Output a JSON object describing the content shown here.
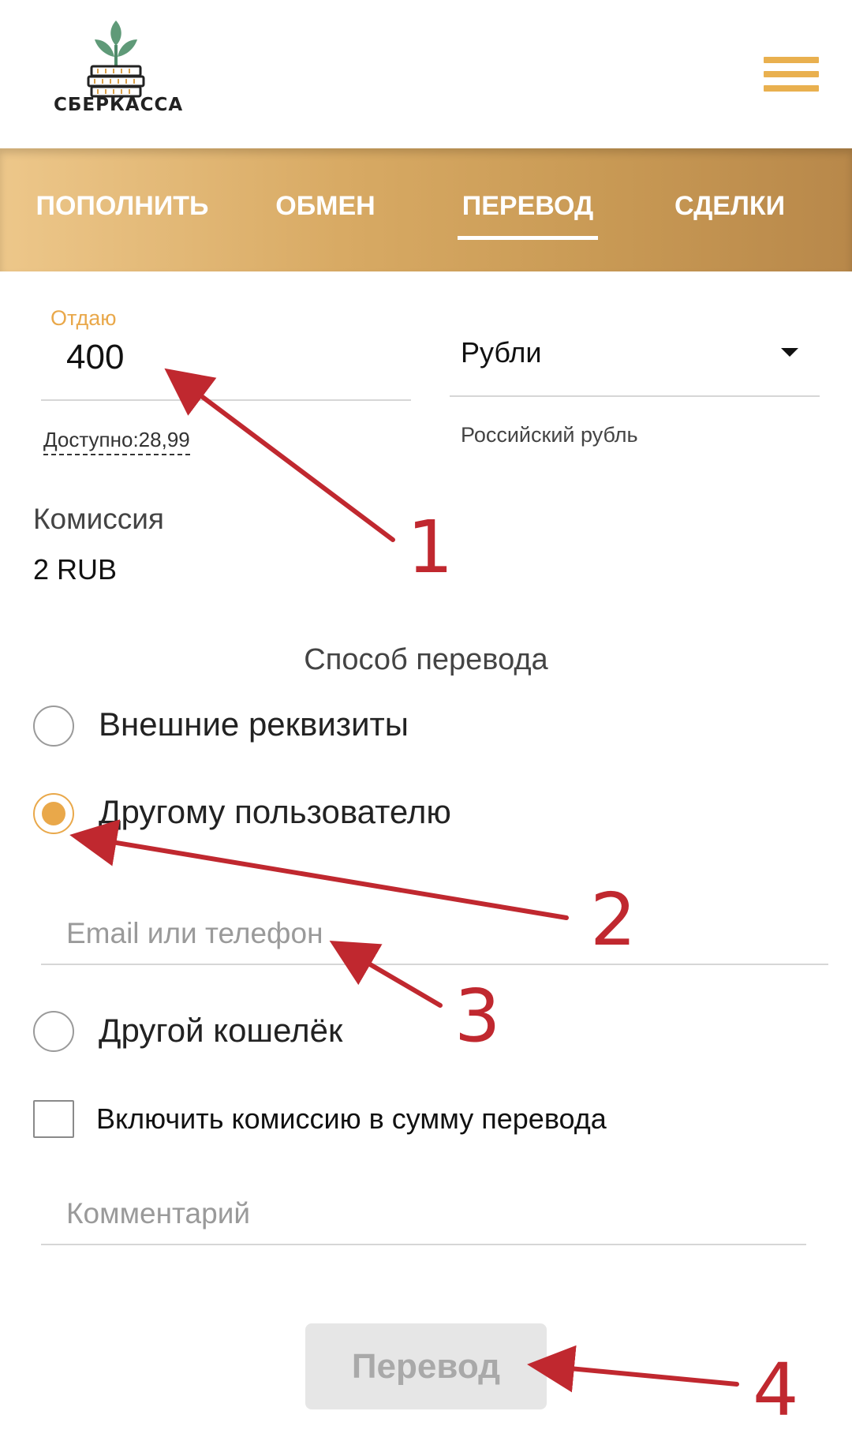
{
  "header": {
    "logo_text": "СБЕРКАССА",
    "menu_icon": "hamburger-menu-icon"
  },
  "nav": {
    "tabs": [
      {
        "label": "ПОПОЛНИТЬ"
      },
      {
        "label": "ОБМЕН"
      },
      {
        "label": "ПЕРЕВОД",
        "active": true
      },
      {
        "label": "СДЕЛКИ"
      }
    ]
  },
  "form": {
    "give_label": "Отдаю",
    "give_value": "400",
    "available": "Доступно:28,99",
    "currency_selected": "Рубли",
    "currency_hint": "Российский рубль",
    "commission_label": "Комиссия",
    "commission_value": "2 RUB",
    "method_title": "Способ перевода",
    "methods": [
      {
        "label": "Внешние реквизиты",
        "checked": false
      },
      {
        "label": "Другому пользователю",
        "checked": true
      },
      {
        "label": "Другой кошелёк",
        "checked": false
      }
    ],
    "recipient_placeholder": "Email или телефон",
    "include_commission_label": "Включить комиссию в сумму перевода",
    "include_commission_checked": false,
    "comment_placeholder": "Комментарий",
    "submit_label": "Перевод"
  },
  "annotations": [
    "1",
    "2",
    "3",
    "4"
  ],
  "colors": {
    "accent": "#e9a84a",
    "nav_gradient_start": "#edc78a",
    "nav_gradient_end": "#b8884a",
    "annotation_red": "#c0282f",
    "button_disabled_bg": "#e6e6e6"
  }
}
